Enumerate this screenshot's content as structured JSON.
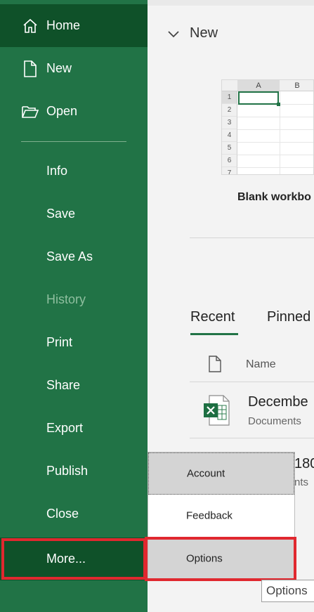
{
  "sidebar": {
    "top_items": [
      {
        "label": "Home",
        "icon": "home-icon"
      },
      {
        "label": "New",
        "icon": "new-file-icon"
      },
      {
        "label": "Open",
        "icon": "open-folder-icon"
      }
    ],
    "items": [
      {
        "label": "Info"
      },
      {
        "label": "Save"
      },
      {
        "label": "Save As"
      },
      {
        "label": "History",
        "disabled": true
      },
      {
        "label": "Print"
      },
      {
        "label": "Share"
      },
      {
        "label": "Export"
      },
      {
        "label": "Publish"
      },
      {
        "label": "Close"
      }
    ],
    "more_label": "More..."
  },
  "main": {
    "new_section": {
      "title": "New",
      "template_label": "Blank workbo",
      "thumbnail": {
        "columns": [
          "A",
          "B"
        ],
        "rows": [
          "1",
          "2",
          "3",
          "4",
          "5",
          "6",
          "7"
        ]
      }
    },
    "tabs": [
      {
        "label": "Recent"
      },
      {
        "label": "Pinned"
      }
    ],
    "list_header": {
      "name": "Name"
    },
    "files": [
      {
        "name": "Decembe",
        "path": "Documents"
      },
      {
        "name": "180",
        "path": "nts"
      }
    ]
  },
  "flyout": {
    "items": [
      {
        "label": "Account"
      },
      {
        "label": "Feedback"
      },
      {
        "label": "Options"
      }
    ]
  },
  "tooltip": {
    "text": "Options"
  },
  "colors": {
    "accent": "#217346",
    "accent_dark": "#0f5129",
    "highlight": "#e0282f"
  }
}
